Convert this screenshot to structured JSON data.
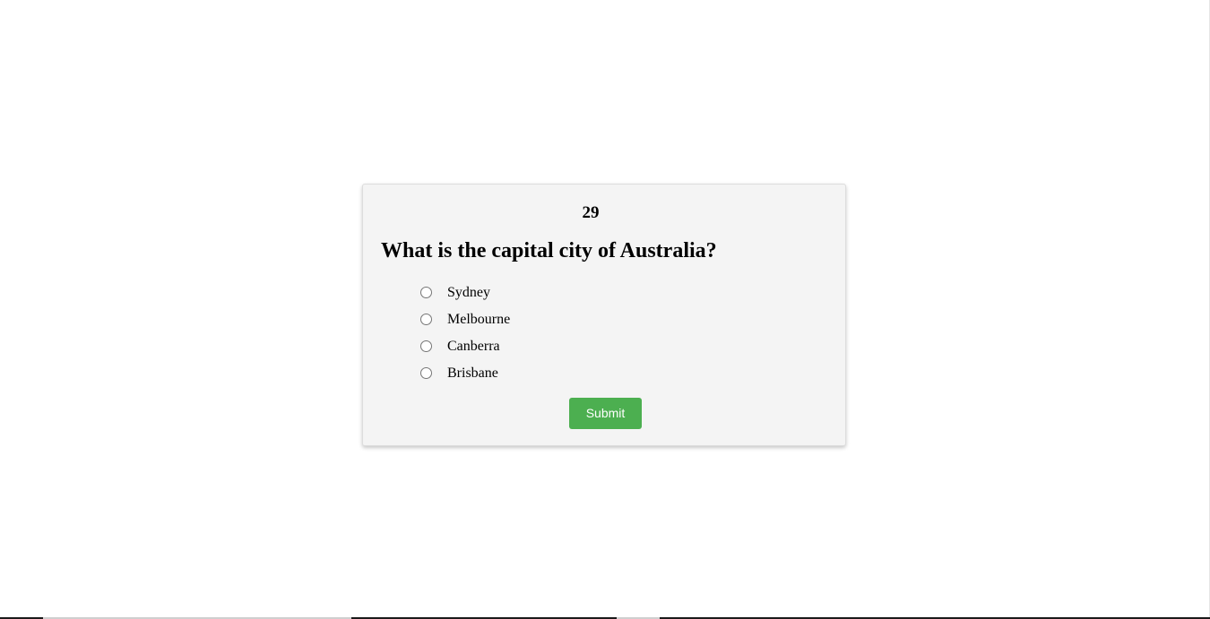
{
  "quiz": {
    "timer": "29",
    "question": "What is the capital city of Australia?",
    "options": [
      {
        "label": "Sydney",
        "selected": false
      },
      {
        "label": "Melbourne",
        "selected": false
      },
      {
        "label": "Canberra",
        "selected": false
      },
      {
        "label": "Brisbane",
        "selected": false
      }
    ],
    "submit_label": "Submit"
  },
  "colors": {
    "card_background": "#f4f4f4",
    "submit_background": "#4caf50",
    "submit_text": "#ffffff"
  }
}
